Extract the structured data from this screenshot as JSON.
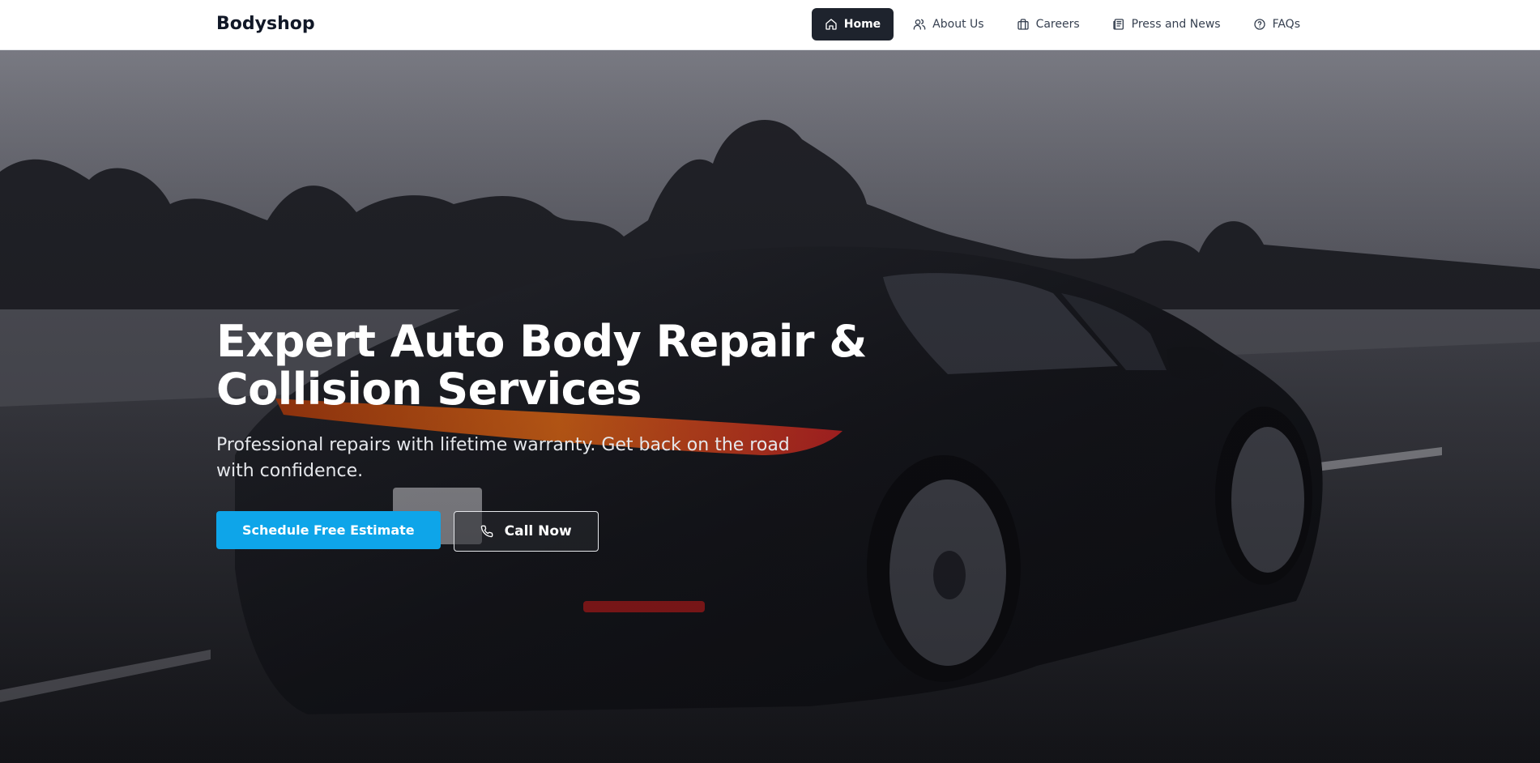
{
  "header": {
    "brand": "Bodyshop",
    "nav": [
      {
        "label": "Home",
        "icon": "home-icon",
        "active": true
      },
      {
        "label": "About Us",
        "icon": "users-icon",
        "active": false
      },
      {
        "label": "Careers",
        "icon": "briefcase-icon",
        "active": false
      },
      {
        "label": "Press and News",
        "icon": "newspaper-icon",
        "active": false
      },
      {
        "label": "FAQs",
        "icon": "help-circle-icon",
        "active": false
      }
    ]
  },
  "hero": {
    "title_line1": "Expert Auto Body Repair &",
    "title_line2": "Collision Services",
    "subtitle": "Professional repairs with lifetime warranty. Get back on the road with confidence.",
    "primary_button": "Schedule Free Estimate",
    "secondary_button": "Call Now",
    "secondary_icon": "phone-icon",
    "background_image": "dark-sports-car-on-highway"
  },
  "colors": {
    "accent": "#0ea5e9",
    "nav_active_bg": "#1e232d",
    "header_bg": "#ffffff",
    "text_dark": "#111827"
  }
}
